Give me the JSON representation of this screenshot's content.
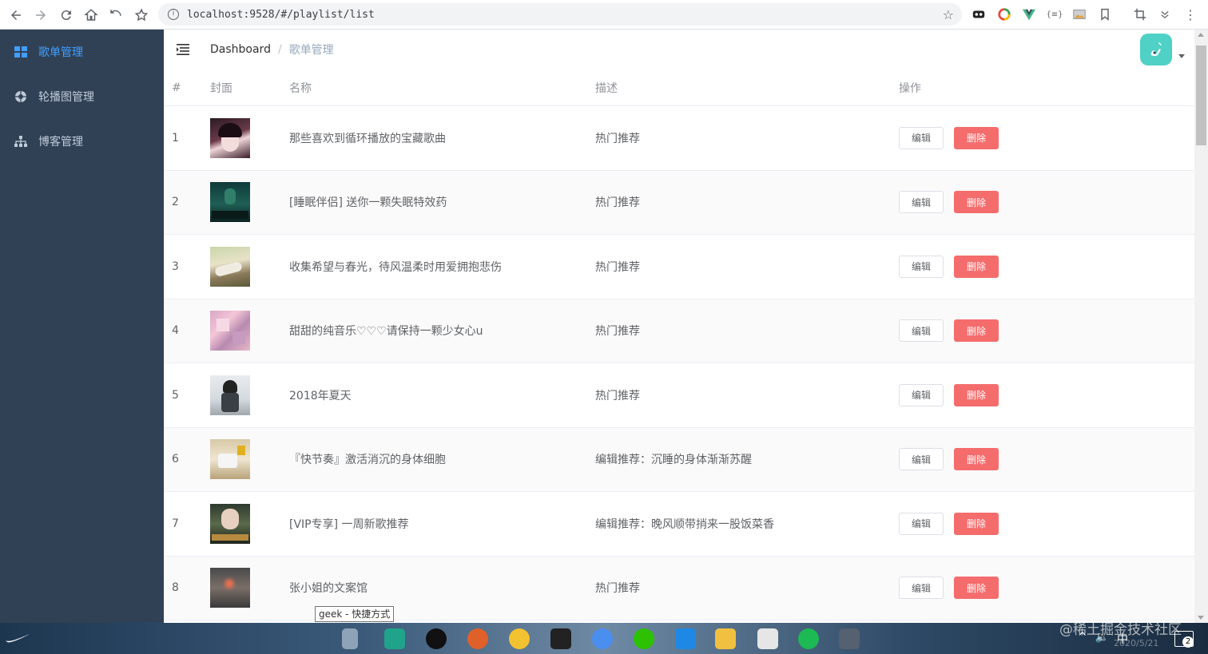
{
  "browser": {
    "url": "localhost:9528/#/playlist/list"
  },
  "sidebar": {
    "items": [
      {
        "label": "歌单管理",
        "icon": "grid-icon",
        "active": true
      },
      {
        "label": "轮播图管理",
        "icon": "aperture-icon",
        "active": false
      },
      {
        "label": "博客管理",
        "icon": "tree-icon",
        "active": false
      }
    ]
  },
  "navbar": {
    "breadcrumb_home": "Dashboard",
    "breadcrumb_sep": "/",
    "breadcrumb_current": "歌单管理"
  },
  "table": {
    "columns": [
      "#",
      "封面",
      "名称",
      "描述",
      "操作"
    ],
    "edit_label": "编辑",
    "delete_label": "删除",
    "rows": [
      {
        "idx": "1",
        "name": "那些喜欢到循环播放的宝藏歌曲",
        "desc": "热门推荐"
      },
      {
        "idx": "2",
        "name": "[睡眠伴侣] 送你一颗失眠特效药",
        "desc": "热门推荐"
      },
      {
        "idx": "3",
        "name": "收集希望与春光，待风温柔时用爱拥抱悲伤",
        "desc": "热门推荐"
      },
      {
        "idx": "4",
        "name": "甜甜的纯音乐♡♡♡请保持一颗少女心u",
        "desc": "热门推荐"
      },
      {
        "idx": "5",
        "name": "2018年夏天",
        "desc": "热门推荐"
      },
      {
        "idx": "6",
        "name": "『快节奏』激活消沉的身体细胞",
        "desc": "编辑推荐：沉睡的身体渐渐苏醒"
      },
      {
        "idx": "7",
        "name": "[VIP专享] 一周新歌推荐",
        "desc": "编辑推荐：晚风顺带捎来一股饭菜香"
      },
      {
        "idx": "8",
        "name": "张小姐的文案馆",
        "desc": "热门推荐"
      }
    ]
  },
  "tooltip": "geek - 快捷方式",
  "taskbar": {
    "tray_text": "中",
    "watermark": "@稀土掘金技术社区",
    "date": "2020/5/21",
    "notifications": "2"
  },
  "colors": {
    "sidebar_bg": "#304156",
    "active": "#409eff",
    "danger": "#f56c6c"
  }
}
